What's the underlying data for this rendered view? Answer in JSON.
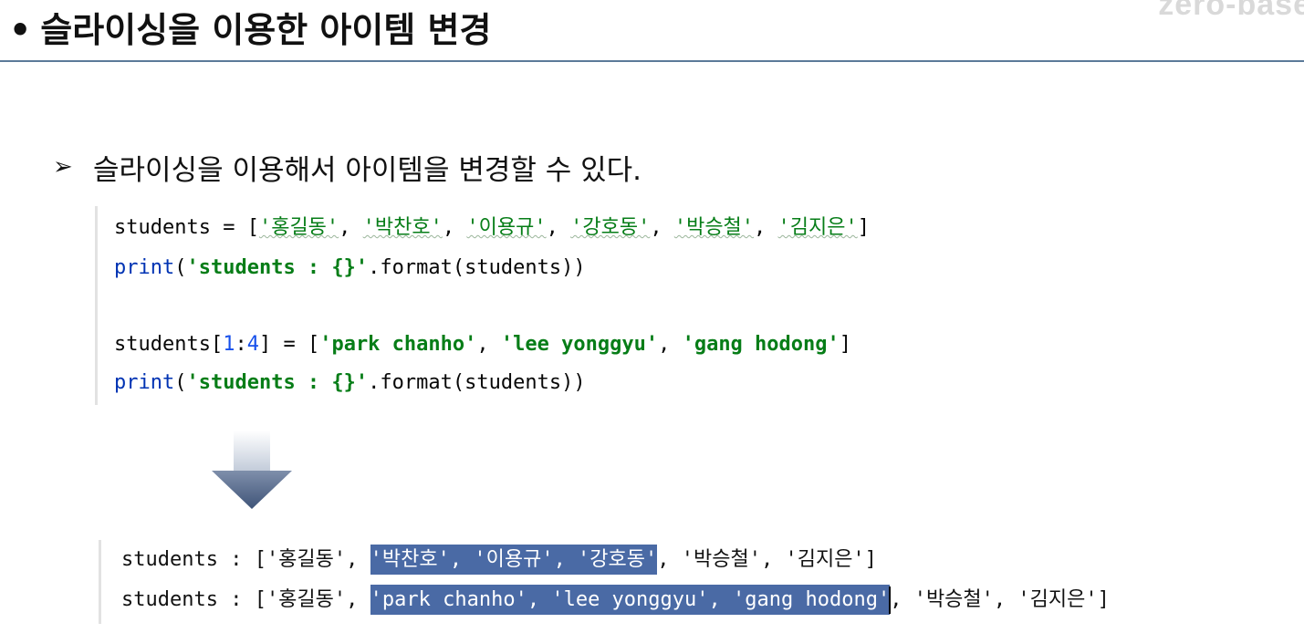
{
  "slide": {
    "watermark": "zero-base",
    "title": "슬라이싱을 이용한 아이템 변경",
    "title_bullet": "•",
    "bullet_marker": "➢",
    "bullet_text": "슬라이싱을 이용해서 아이템을 변경할 수 있다."
  },
  "code": {
    "line1": {
      "prefix": "students = [",
      "items": [
        "'홍길동'",
        "'박찬호'",
        "'이용규'",
        "'강호동'",
        "'박승철'",
        "'김지은'"
      ],
      "separator": ", ",
      "suffix": "]"
    },
    "line2": {
      "fn": "print",
      "open": "(",
      "str": "'students : {}'",
      "rest": ".format(students))"
    },
    "line3": {
      "prefix": "students[",
      "start": "1",
      "colon": ":",
      "end": "4",
      "mid": "] = [",
      "items": [
        "'park chanho'",
        "'lee yonggyu'",
        "'gang hodong'"
      ],
      "separator": ", ",
      "suffix": "]"
    },
    "line4": {
      "fn": "print",
      "open": "(",
      "str": "'students : {}'",
      "rest": ".format(students))"
    }
  },
  "output": {
    "line1": {
      "prefix": "students : ['홍길동', ",
      "highlight": "'박찬호', '이용규', '강호동'",
      "suffix": ", '박승철', '김지은']"
    },
    "line2": {
      "prefix": "students : ['홍길동', ",
      "highlight": "'park chanho', 'lee yonggyu', 'gang hodong'",
      "suffix": ", '박승철', '김지은']"
    }
  },
  "colors": {
    "string": "#067d17",
    "function": "#0033b3",
    "number": "#1750eb",
    "highlight_bg": "#4a6aa5",
    "title_rule": "#5b7a99"
  }
}
